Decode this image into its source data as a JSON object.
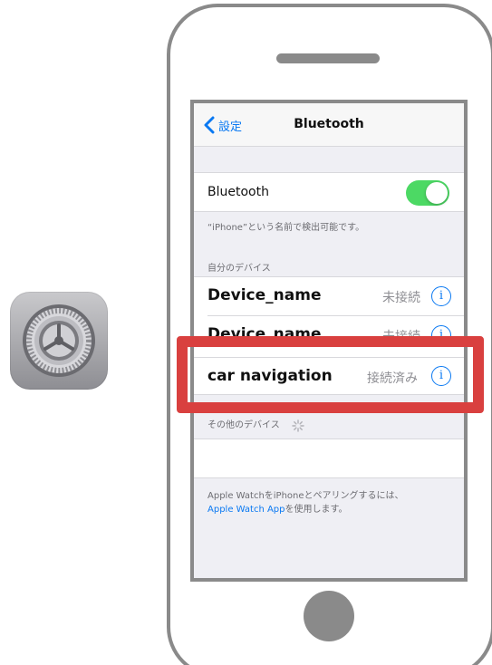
{
  "settings_icon": {
    "name": "settings-app-icon",
    "gear_color": "#7b7b80"
  },
  "nav": {
    "back_label": "設定",
    "title": "Bluetooth"
  },
  "bluetooth_row": {
    "label": "Bluetooth",
    "toggle_on": true,
    "toggle_color": "#4cd964"
  },
  "discoverable_note": "“iPhone”という名前で検出可能です。",
  "my_devices": {
    "header": "自分のデバイス",
    "items": [
      {
        "name": "Device_name",
        "status": "未接続"
      },
      {
        "name": "Device_name",
        "status": "未接続"
      },
      {
        "name": "car navigation",
        "status": "接続済み"
      }
    ]
  },
  "other_devices": {
    "header": "その他のデバイス"
  },
  "apple_watch_note": {
    "line1": "Apple WatchをiPhoneとペアリングするには、",
    "link": "Apple Watch App",
    "line2_suffix": "を使用します。"
  },
  "colors": {
    "accent": "#0a79f2",
    "highlight": "#d9403f",
    "phone_frame": "#8a8a8a"
  }
}
